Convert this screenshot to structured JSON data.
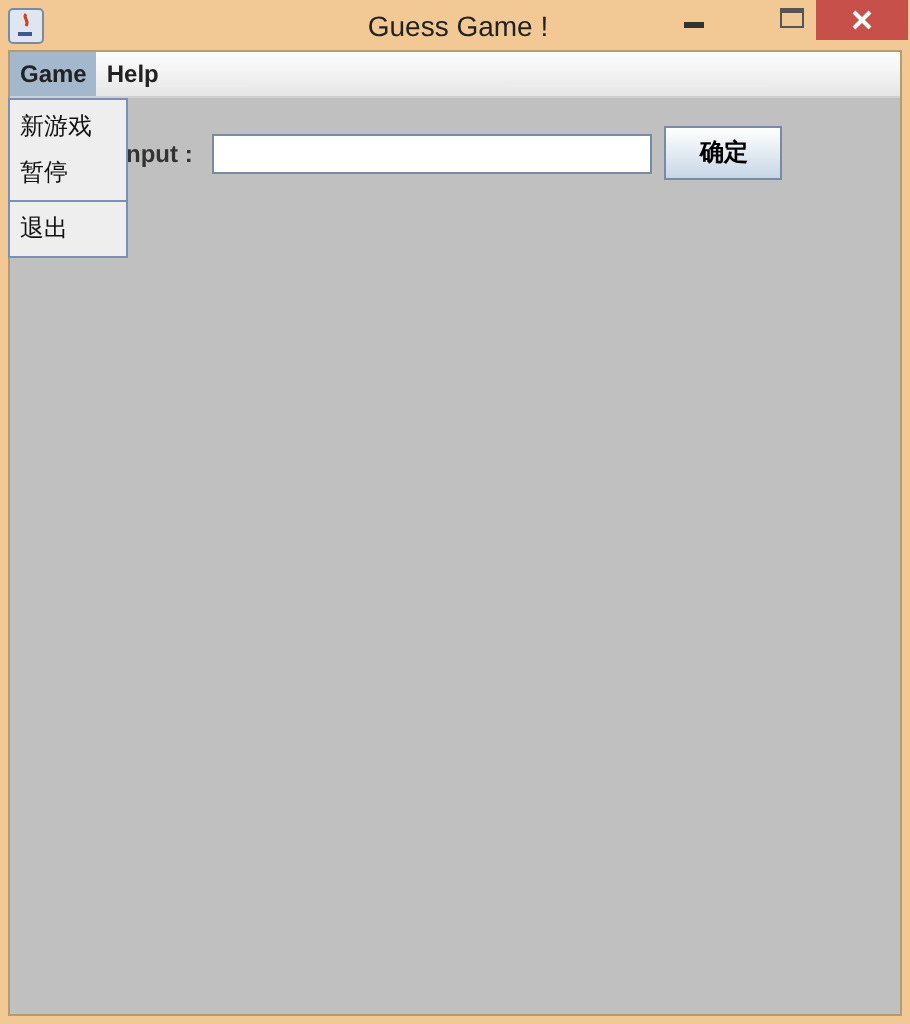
{
  "window": {
    "title": "Guess Game !"
  },
  "menubar": [
    {
      "label": "Game",
      "selected": true
    },
    {
      "label": "Help",
      "selected": false
    }
  ],
  "menu": {
    "groups": [
      [
        "新游戏",
        "暂停"
      ],
      [
        "退出"
      ]
    ]
  },
  "form": {
    "label": "nput :",
    "button": "确定"
  }
}
